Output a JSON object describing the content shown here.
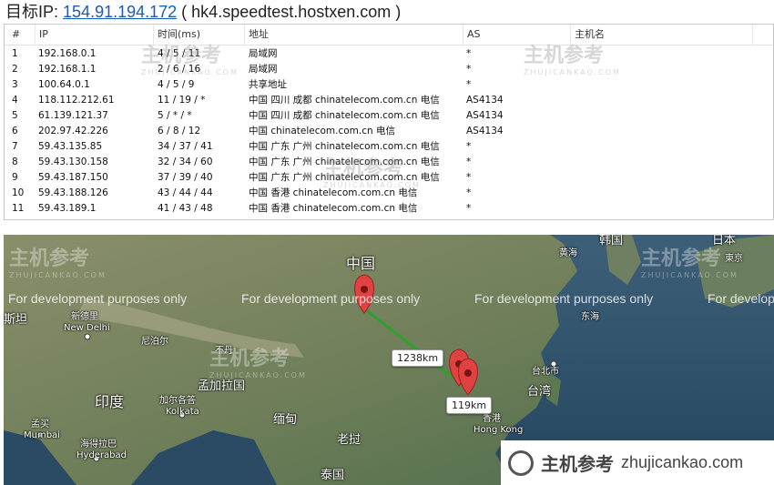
{
  "header": {
    "label": "目标IP:",
    "ip": "154.91.194.172",
    "host": "( hk4.speedtest.hostxen.com )"
  },
  "table": {
    "columns": [
      "#",
      "IP",
      "时间(ms)",
      "地址",
      "AS",
      "主机名"
    ],
    "rows": [
      {
        "n": "1",
        "ip": "192.168.0.1",
        "time": "4 / 5 / 11",
        "addr": "局域网",
        "as": "*"
      },
      {
        "n": "2",
        "ip": "192.168.1.1",
        "time": "2 / 6 / 16",
        "addr": "局域网",
        "as": "*"
      },
      {
        "n": "3",
        "ip": "100.64.0.1",
        "time": "4 / 5 / 9",
        "addr": "共享地址",
        "as": "*"
      },
      {
        "n": "4",
        "ip": "118.112.212.61",
        "time": "11 / 19 / *",
        "addr": "中国 四川 成都 chinatelecom.com.cn 电信",
        "as": "AS4134"
      },
      {
        "n": "5",
        "ip": "61.139.121.37",
        "time": "5 / * / *",
        "addr": "中国 四川 成都 chinatelecom.com.cn 电信",
        "as": "AS4134"
      },
      {
        "n": "6",
        "ip": "202.97.42.226",
        "time": "6 / 8 / 12",
        "addr": "中国 chinatelecom.com.cn 电信",
        "as": "AS4134"
      },
      {
        "n": "7",
        "ip": "59.43.135.85",
        "time": "34 / 37 / 41",
        "addr": "中国 广东 广州 chinatelecom.com.cn 电信",
        "as": "*"
      },
      {
        "n": "8",
        "ip": "59.43.130.158",
        "time": "32 / 34 / 60",
        "addr": "中国 广东 广州 chinatelecom.com.cn 电信",
        "as": "*"
      },
      {
        "n": "9",
        "ip": "59.43.187.150",
        "time": "37 / 39 / 40",
        "addr": "中国 广东 广州 chinatelecom.com.cn 电信",
        "as": "*"
      },
      {
        "n": "10",
        "ip": "59.43.188.126",
        "time": "43 / 44 / 44",
        "addr": "中国 香港 chinatelecom.com.cn 电信",
        "as": "*"
      },
      {
        "n": "11",
        "ip": "59.43.189.1",
        "time": "41 / 43 / 48",
        "addr": "中国 香港 chinatelecom.com.cn 电信",
        "as": "*"
      }
    ]
  },
  "map": {
    "dev_notice": "For development purposes only",
    "distances": [
      "1238km",
      "119km"
    ],
    "labels": {
      "china": "中国",
      "korea": "韩国",
      "japan": "日本",
      "tokyo": "東京",
      "yellow_sea": "黄海",
      "east_sea": "东海",
      "taipei": "台北市",
      "taiwan": "台湾",
      "hk_cn": "香港",
      "hk_en": "Hong Kong",
      "india": "印度",
      "newdelhi_cn": "新德里",
      "newdelhi_en": "New Delhi",
      "nepal": "尼泊尔",
      "bhutan": "不丹",
      "bangladesh": "孟加拉国",
      "kolkata_cn": "加尔各答",
      "kolkata_en": "Kolkata",
      "myanmar": "缅甸",
      "laos": "老挝",
      "thailand": "泰国",
      "mumbai_cn": "孟买",
      "mumbai_en": "Mumbai",
      "hyderabad_cn": "海得拉巴",
      "hyderabad_en": "Hyderabad",
      "pakistan_fragment": "斯坦"
    }
  },
  "watermark": {
    "cn": "主机参考",
    "en": "ZHUJICANKAO.COM"
  },
  "brand": {
    "name": "主机参考",
    "url": "zhujicankao.com"
  }
}
